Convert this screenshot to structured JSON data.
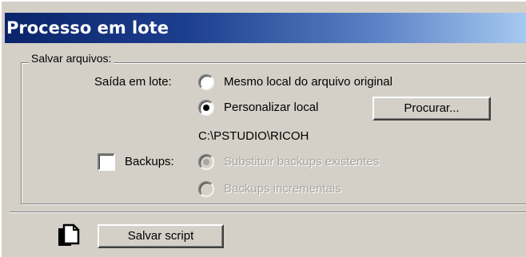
{
  "window": {
    "title": "Processo em lote"
  },
  "group": {
    "legend": "Salvar arquivos:"
  },
  "output": {
    "label": "Saída em lote:",
    "options": [
      {
        "label": "Mesmo local do arquivo original",
        "selected": false,
        "enabled": true
      },
      {
        "label": "Personalizar local",
        "selected": true,
        "enabled": true
      }
    ],
    "browse_label": "Procurar...",
    "path": "C:\\PSTUDIO\\RICOH"
  },
  "backups": {
    "label": "Backups:",
    "checked": false,
    "options": [
      {
        "label": "Substituir backups existentes",
        "selected": true,
        "enabled": false
      },
      {
        "label": "Backups incrementais",
        "selected": false,
        "enabled": false
      }
    ]
  },
  "footer": {
    "save_script_label": "Salvar script",
    "icon": "script-document-icon"
  }
}
